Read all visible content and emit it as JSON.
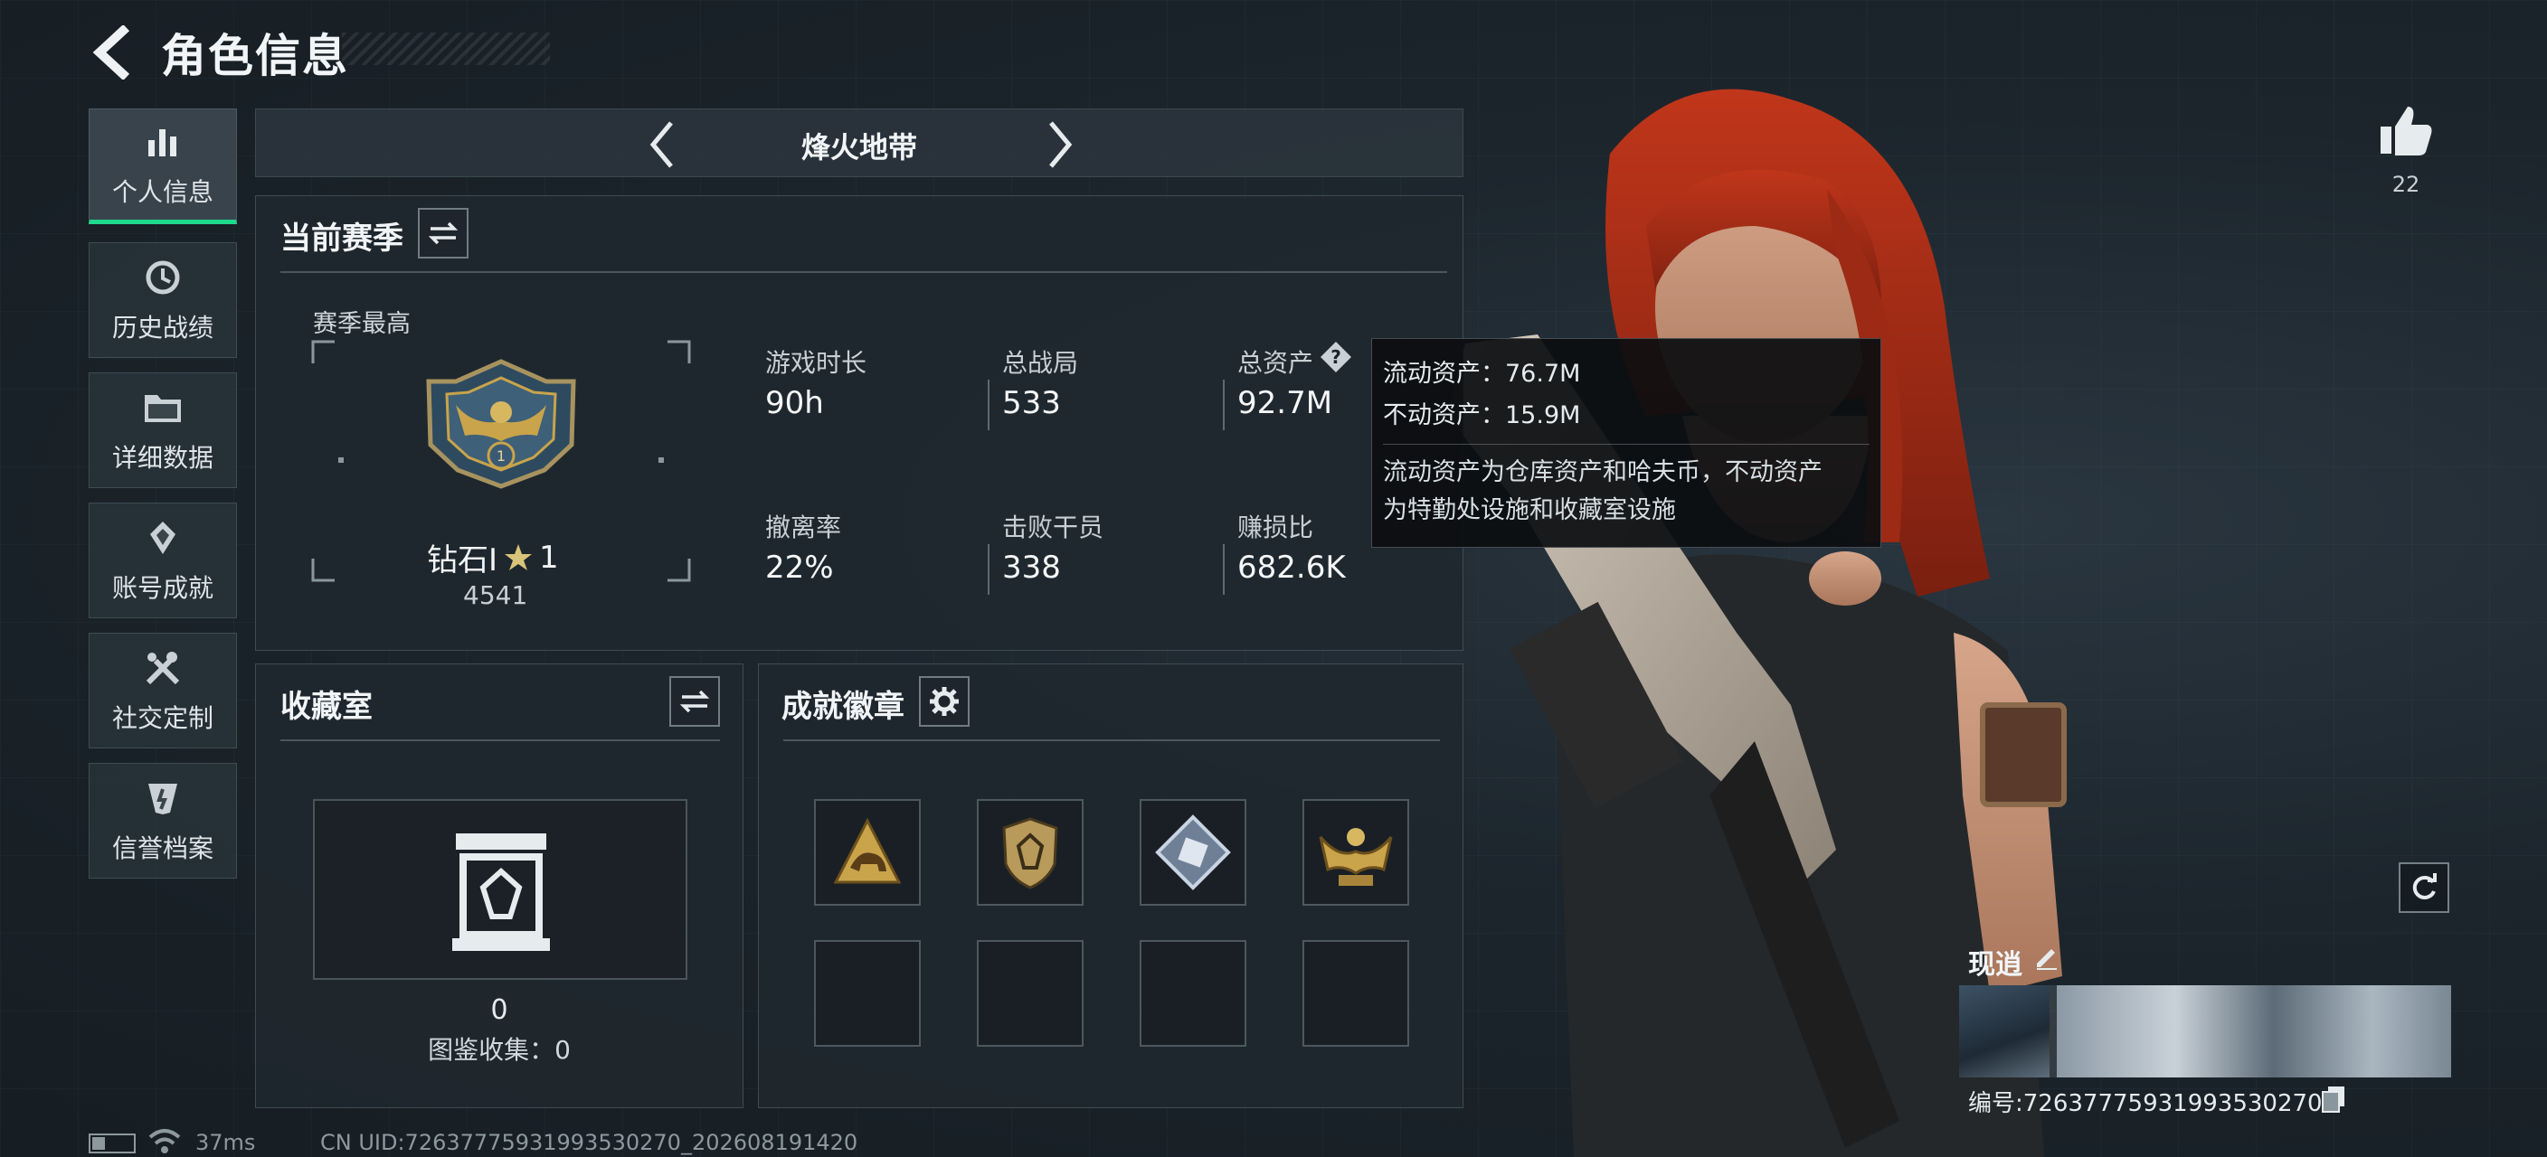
{
  "header": {
    "title": "角色信息"
  },
  "nav": [
    {
      "label": "个人信息",
      "icon": "bar-chart-icon",
      "active": true
    },
    {
      "label": "历史战绩",
      "icon": "history-icon",
      "active": false
    },
    {
      "label": "详细数据",
      "icon": "folder-icon",
      "active": false
    },
    {
      "label": "账号成就",
      "icon": "medal-icon",
      "active": false
    },
    {
      "label": "社交定制",
      "icon": "tools-icon",
      "active": false
    },
    {
      "label": "信誉档案",
      "icon": "shield-icon",
      "active": false
    }
  ],
  "mode": {
    "label": "烽火地带"
  },
  "season": {
    "title": "当前赛季",
    "best_label": "赛季最高",
    "rank_name": "钻石I",
    "rank_stars": "1",
    "rank_score": "4541",
    "stats": [
      {
        "label": "游戏时长",
        "value": "90h"
      },
      {
        "label": "总战局",
        "value": "533"
      },
      {
        "label": "总资产",
        "value": "92.7M"
      },
      {
        "label": "撤离率",
        "value": "22%"
      },
      {
        "label": "击败干员",
        "value": "338"
      },
      {
        "label": "赚损比",
        "value": "682.6K"
      }
    ]
  },
  "tooltip": {
    "liquid": "流动资产：76.7M",
    "fixed": "不动资产：15.9M",
    "note_line1": "流动资产为仓库资产和哈夫币，不动资产",
    "note_line2": "为特勤处设施和收藏室设施"
  },
  "collection": {
    "title": "收藏室",
    "count": "0",
    "catalog": "图鉴收集：0"
  },
  "badges": {
    "title": "成就徽章",
    "icons": [
      "mammoth-badge-icon",
      "shield-badge-icon",
      "diamond-badge-icon",
      "eagle-badge-icon"
    ]
  },
  "right": {
    "likes": "22",
    "char_name": "现逍",
    "uid": "编号:7263777593199353027​0"
  },
  "footer": {
    "ping": "37ms",
    "uid": "CN UID:7263777593199353027​0_202608191420"
  },
  "colors": {
    "accent": "#1fd98d",
    "gold": "#c9a44a"
  }
}
